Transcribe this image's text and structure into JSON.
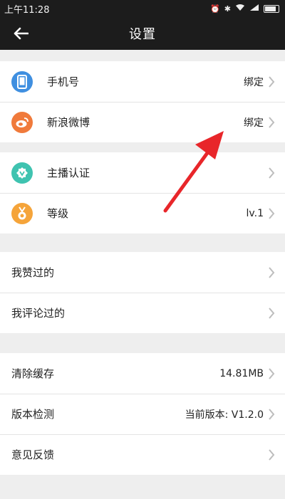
{
  "status_bar": {
    "time": "上午11:28",
    "icons": [
      "alarm-icon",
      "bluetooth-icon",
      "wifi-icon",
      "signal-icon",
      "battery-icon"
    ]
  },
  "header": {
    "title": "设置",
    "back_icon": "back-arrow-icon"
  },
  "groups": {
    "account": {
      "phone": {
        "label": "手机号",
        "value": "绑定",
        "icon": "phone-icon",
        "color": "#3f8fe0"
      },
      "weibo": {
        "label": "新浪微博",
        "value": "绑定",
        "icon": "weibo-icon",
        "color": "#f07a3b"
      }
    },
    "profile": {
      "anchor": {
        "label": "主播认证",
        "icon": "verified-badge-icon",
        "color": "#3fc3b0"
      },
      "level": {
        "label": "等级",
        "value": "lv.1",
        "icon": "medal-icon",
        "color": "#f5a43a"
      }
    },
    "history": {
      "liked": {
        "label": "我赞过的"
      },
      "commented": {
        "label": "我评论过的"
      }
    },
    "system": {
      "cache": {
        "label": "清除缓存",
        "value": "14.81MB"
      },
      "version": {
        "label": "版本检测",
        "value": "当前版本: V1.2.0"
      },
      "feedback": {
        "label": "意见反馈"
      }
    }
  },
  "colors": {
    "annotation_arrow": "#e8262a",
    "chevron": "#bdbdbd"
  }
}
